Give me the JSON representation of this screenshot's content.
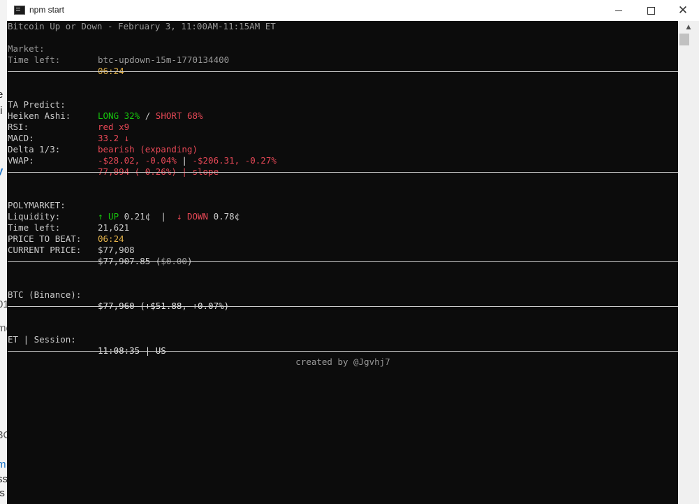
{
  "window": {
    "title": "npm start"
  },
  "background_app": {
    "fragments": [
      "e",
      "ti",
      "y",
      "01",
      "me",
      "3C",
      "m",
      "ss",
      "is"
    ]
  },
  "header": {
    "title": "Bitcoin Up or Down - February 3, 11:00AM-11:15AM ET",
    "market_label": "Market:",
    "market_value": "btc-updown-15m-1770134400",
    "time_left_label": "Time left:",
    "time_left_value": "06:24"
  },
  "ta": {
    "predict_label": "TA Predict:",
    "long": "LONG 32%",
    "slash": " / ",
    "short": "SHORT 68%",
    "heiken_label": "Heiken Ashi:",
    "heiken_value": "red x9",
    "rsi_label": "RSI:",
    "rsi_value": "33.2 ↓",
    "macd_label": "MACD:",
    "macd_value": "bearish (expanding)",
    "delta_label": "Delta 1/3:",
    "delta_a": "-$28.02, -0.04%",
    "delta_sep": " | ",
    "delta_b": "-$206.31, -0.27%",
    "vwap_label": "VWAP:",
    "vwap_value": "77,894 (-0.26%) | slope"
  },
  "polymarket": {
    "label": "POLYMARKET:",
    "up_arrow_label": "↑ UP",
    "up_value": " 0.21¢",
    "divider": "  |  ",
    "down_arrow_label": "↓ DOWN",
    "down_value": " 0.78¢",
    "liquidity_label": "Liquidity:",
    "liquidity_value": "21,621",
    "time_left_label": "Time left:",
    "time_left_value": "06:24",
    "price_to_beat_label": "PRICE TO BEAT:",
    "price_to_beat_value": "$77,908",
    "current_price_label": "CURRENT PRICE:",
    "current_price_value": "$77,907.85 (",
    "current_price_diff": "$0.00",
    "current_price_close": ")"
  },
  "binance": {
    "label": "BTC (Binance):",
    "value": "$77,960 (+$51.88, +0.07%)"
  },
  "session": {
    "label": "ET | Session:",
    "value": "11:08:35 | US"
  },
  "footer": {
    "credit": "created by @Jgvhj7"
  },
  "colors": {
    "background": "#0c0c0c",
    "text": "#cccccc",
    "green": "#16c60c",
    "red": "#e74856",
    "gold": "#e5b44b",
    "gray": "#999999"
  }
}
